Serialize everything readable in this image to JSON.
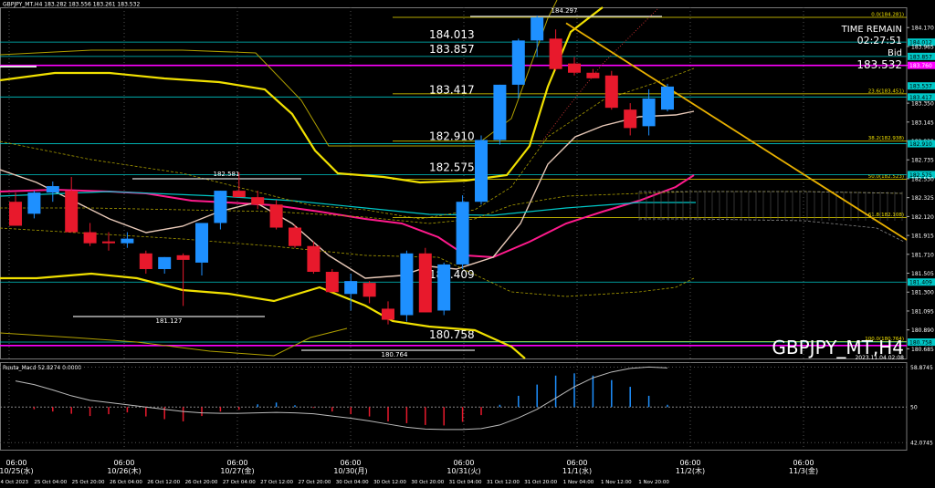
{
  "window": {
    "header": "GBPJPY_MT,H4  183.282 183.556 183.261 183.532",
    "symbol_watermark": "GBPJPY_MT,H4",
    "timestamp": "2023.11.04 02:08"
  },
  "info_panel": {
    "time_remain_label": "TIME REMAIN",
    "time_remain_value": "02:27:51",
    "bid_label": "Bid",
    "bid_value": "183.532"
  },
  "chart_data": {
    "type": "candlestick",
    "ylim": [
      180.58,
      184.39
    ],
    "price_ticks": [
      "184.170",
      "184.012",
      "183.965",
      "183.857",
      "183.760",
      "183.537",
      "183.417",
      "183.350",
      "183.145",
      "182.938",
      "182.910",
      "182.735",
      "182.575",
      "182.530",
      "182.325",
      "182.120",
      "181.915",
      "181.710",
      "181.505",
      "181.409",
      "181.300",
      "181.095",
      "180.890",
      "180.758",
      "180.685"
    ],
    "price_tick_colors": {
      "184.012": "#00c8c8",
      "183.857": "#00c8c8",
      "183.537": "#00c8c8",
      "183.417": "#00c8c8",
      "182.910": "#00c8c8",
      "182.575": "#00c8c8",
      "181.409": "#00c8c8",
      "180.758": "#00c8c8"
    },
    "date_labels": [
      "06:00\n10/25(水)",
      "06:00\n10/26(木)",
      "06:00\n10/27(金)",
      "06:00\n10/30(月)",
      "06:00\n10/31(火)",
      "06:00\n11/1(水)",
      "06:00\n11/2(木)",
      "06:00\n11/3(金)"
    ],
    "time_labels": [
      "24 Oct 2023",
      "25 Oct 04:00",
      "25 Oct 20:00",
      "26 Oct 12:00",
      "27 Oct 04:00",
      "27 Oct 20:00",
      "30 Oct 12:00",
      "31 Oct 04:00",
      "31 Oct 20:00",
      "1 Nov 12:00"
    ],
    "bottom_time_labels": [
      "24 Oct 2023",
      "25 Oct 04:00",
      "25 Oct 20:00",
      "26 Oct 04:00",
      "26 Oct 12:00",
      "26 Oct 20:00",
      "27 Oct 04:00",
      "27 Oct 12:00",
      "27 Oct 20:00",
      "30 Oct 04:00",
      "30 Oct 12:00",
      "30 Oct 20:00",
      "31 Oct 04:00",
      "31 Oct 12:00",
      "31 Oct 20:00",
      "1 Nov 04:00",
      "1 Nov 12:00",
      "1 Nov 20:00"
    ],
    "candles": [
      {
        "o": 182.28,
        "h": 182.38,
        "l": 182.02,
        "c": 182.02
      },
      {
        "o": 182.15,
        "h": 182.4,
        "l": 182.1,
        "c": 182.38
      },
      {
        "o": 182.38,
        "h": 182.5,
        "l": 182.28,
        "c": 182.45
      },
      {
        "o": 182.4,
        "h": 182.55,
        "l": 181.95,
        "c": 181.95
      },
      {
        "o": 181.95,
        "h": 182.05,
        "l": 181.8,
        "c": 181.83
      },
      {
        "o": 181.85,
        "h": 181.95,
        "l": 181.75,
        "c": 181.83
      },
      {
        "o": 181.83,
        "h": 181.95,
        "l": 181.78,
        "c": 181.88
      },
      {
        "o": 181.72,
        "h": 181.75,
        "l": 181.5,
        "c": 181.55
      },
      {
        "o": 181.55,
        "h": 181.68,
        "l": 181.5,
        "c": 181.68
      },
      {
        "o": 181.7,
        "h": 181.72,
        "l": 181.15,
        "c": 181.65
      },
      {
        "o": 181.62,
        "h": 182.05,
        "l": 181.48,
        "c": 182.05
      },
      {
        "o": 182.05,
        "h": 182.4,
        "l": 181.98,
        "c": 182.4
      },
      {
        "o": 182.4,
        "h": 182.6,
        "l": 182.33,
        "c": 182.33
      },
      {
        "o": 182.33,
        "h": 182.4,
        "l": 182.2,
        "c": 182.25
      },
      {
        "o": 182.25,
        "h": 182.3,
        "l": 181.98,
        "c": 182.0
      },
      {
        "o": 182.0,
        "h": 182.03,
        "l": 181.78,
        "c": 181.8
      },
      {
        "o": 181.8,
        "h": 181.85,
        "l": 181.5,
        "c": 181.52
      },
      {
        "o": 181.52,
        "h": 181.55,
        "l": 181.3,
        "c": 181.3
      },
      {
        "o": 181.28,
        "h": 181.5,
        "l": 181.1,
        "c": 181.42
      },
      {
        "o": 181.4,
        "h": 181.42,
        "l": 181.18,
        "c": 181.25
      },
      {
        "o": 181.12,
        "h": 181.2,
        "l": 180.95,
        "c": 181.0
      },
      {
        "o": 181.05,
        "h": 181.75,
        "l": 180.98,
        "c": 181.72
      },
      {
        "o": 181.72,
        "h": 181.78,
        "l": 181.08,
        "c": 181.08
      },
      {
        "o": 181.1,
        "h": 181.62,
        "l": 181.05,
        "c": 181.6
      },
      {
        "o": 181.6,
        "h": 182.35,
        "l": 181.55,
        "c": 182.28
      },
      {
        "o": 182.28,
        "h": 183.0,
        "l": 182.25,
        "c": 182.95
      },
      {
        "o": 182.95,
        "h": 183.55,
        "l": 182.9,
        "c": 183.55
      },
      {
        "o": 183.55,
        "h": 184.05,
        "l": 183.4,
        "c": 184.03
      },
      {
        "o": 184.03,
        "h": 184.3,
        "l": 183.85,
        "c": 184.28
      },
      {
        "o": 184.05,
        "h": 184.15,
        "l": 183.7,
        "c": 183.72
      },
      {
        "o": 183.78,
        "h": 183.85,
        "l": 183.65,
        "c": 183.68
      },
      {
        "o": 183.68,
        "h": 183.72,
        "l": 183.62,
        "c": 183.62
      },
      {
        "o": 183.65,
        "h": 183.7,
        "l": 183.28,
        "c": 183.3
      },
      {
        "o": 183.28,
        "h": 183.35,
        "l": 183.0,
        "c": 183.08
      },
      {
        "o": 183.1,
        "h": 183.5,
        "l": 183.0,
        "c": 183.4
      },
      {
        "o": 183.28,
        "h": 183.56,
        "l": 183.26,
        "c": 183.53
      }
    ],
    "h_lines": [
      {
        "price": 184.013,
        "label": "184.013"
      },
      {
        "price": 183.857,
        "label": "183.857"
      },
      {
        "price": 183.417,
        "label": "183.417"
      },
      {
        "price": 182.91,
        "label": "182.910"
      },
      {
        "price": 182.575,
        "label": "182.575"
      },
      {
        "price": 181.409,
        "label": "181.409"
      },
      {
        "price": 180.758,
        "label": "180.758"
      }
    ],
    "fib_levels": [
      {
        "price": 184.281,
        "label": "0.0(184.281)"
      },
      {
        "price": 183.451,
        "label": "23.6(183.451)"
      },
      {
        "price": 182.938,
        "label": "38.2(182.938)"
      },
      {
        "price": 182.523,
        "label": "50.0(182.523)"
      },
      {
        "price": 182.108,
        "label": "61.8(182.108)"
      },
      {
        "price": 180.764,
        "label": "100.0(180.764)"
      }
    ],
    "price_annotations": [
      {
        "price": 184.297,
        "label": "184.297"
      },
      {
        "price": 182.581,
        "label": "182.581"
      },
      {
        "price": 181.127,
        "label": "181.127"
      },
      {
        "price": 180.764,
        "label": "180.764"
      }
    ],
    "indicator": {
      "name": "Ruuta_Macd 52.8274  0.0000",
      "ticks": [
        "58.8745",
        "50",
        "42.0745"
      ],
      "ylim": [
        40.5,
        60.0
      ],
      "bars": [
        0,
        -0.5,
        -1.0,
        -1.5,
        -2.0,
        -1.6,
        -1.2,
        -2.1,
        -2.7,
        -3.2,
        -2.0,
        -1.0,
        -0.6,
        0.6,
        1.0,
        0.4,
        -0.2,
        -1.0,
        -1.6,
        -2.1,
        -3.2,
        -3.6,
        -4.0,
        -4.1,
        -3.3,
        -1.8,
        0.5,
        2.5,
        5.0,
        7.0,
        7.5,
        7.0,
        6.0,
        4.5,
        2.5,
        0.5
      ],
      "signal": [
        55.8,
        55.0,
        53.8,
        52.5,
        51.5,
        51.0,
        50.5,
        50.0,
        49.5,
        49.0,
        48.7,
        48.6,
        48.6,
        48.7,
        48.8,
        48.7,
        48.5,
        48.0,
        47.5,
        46.9,
        46.2,
        45.5,
        45.1,
        45.0,
        45.0,
        45.2,
        46.0,
        47.6,
        49.5,
        52.0,
        54.5,
        56.5,
        57.8,
        58.6,
        58.9,
        58.7
      ]
    }
  },
  "colors": {
    "bull": "#1e90ff",
    "bear": "#e8192c",
    "cyan": "#00c8c8",
    "magenta": "#ff00ff",
    "yellow": "#f0e000",
    "pink_ma": "#ff1a8c",
    "white_ma": "#e8c9b8"
  }
}
